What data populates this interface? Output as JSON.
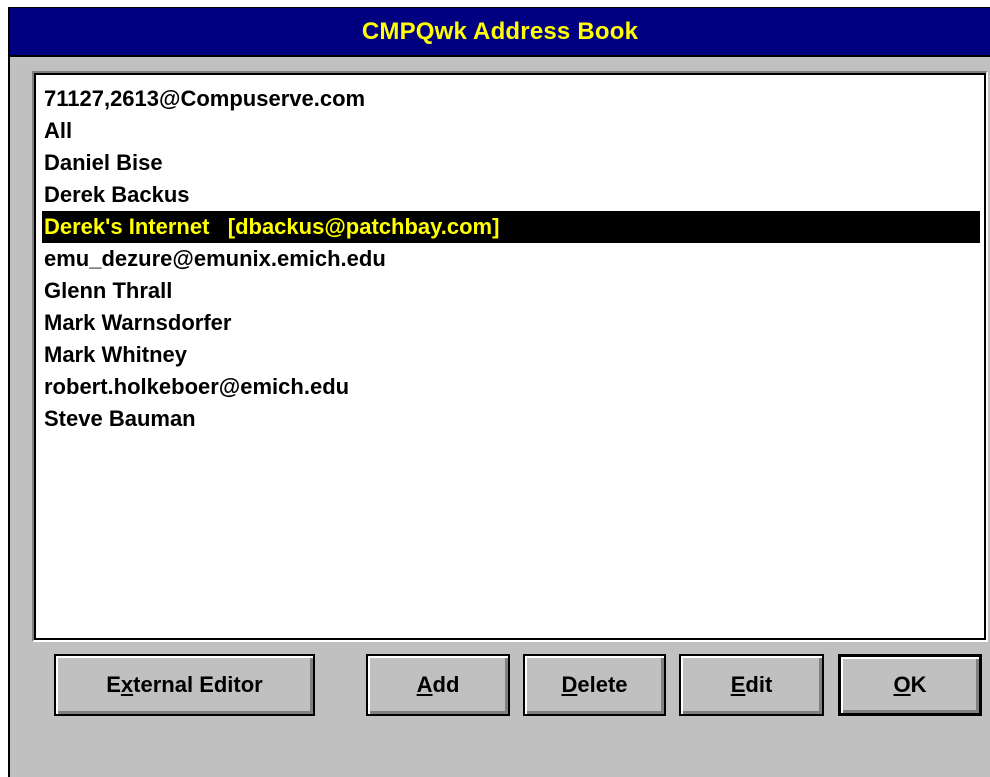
{
  "window": {
    "title": "CMPQwk Address Book"
  },
  "address_list": {
    "items": [
      {
        "label": "71127,2613@Compuserve.com",
        "selected": false
      },
      {
        "label": "All",
        "selected": false
      },
      {
        "label": "Daniel Bise",
        "selected": false
      },
      {
        "label": "Derek Backus",
        "selected": false
      },
      {
        "label": "Derek's Internet   [dbackus@patchbay.com]",
        "selected": true
      },
      {
        "label": "emu_dezure@emunix.emich.edu",
        "selected": false
      },
      {
        "label": "Glenn Thrall",
        "selected": false
      },
      {
        "label": "Mark Warnsdorfer",
        "selected": false
      },
      {
        "label": "Mark Whitney",
        "selected": false
      },
      {
        "label": "robert.holkeboer@emich.edu",
        "selected": false
      },
      {
        "label": "Steve Bauman",
        "selected": false
      }
    ]
  },
  "buttons": {
    "external_editor": {
      "pre": "E",
      "mnemonic": "x",
      "post": "ternal Editor"
    },
    "add": {
      "pre": "",
      "mnemonic": "A",
      "post": "dd"
    },
    "delete": {
      "pre": "",
      "mnemonic": "D",
      "post": "elete"
    },
    "edit": {
      "pre": "",
      "mnemonic": "E",
      "post": "dit"
    },
    "ok": {
      "pre": "",
      "mnemonic": "O",
      "post": "K"
    }
  },
  "colors": {
    "titlebar_bg": "#000080",
    "title_text": "#ffff00",
    "face": "#c0c0c0",
    "selection_bg": "#000000",
    "selection_text": "#ffff00"
  }
}
